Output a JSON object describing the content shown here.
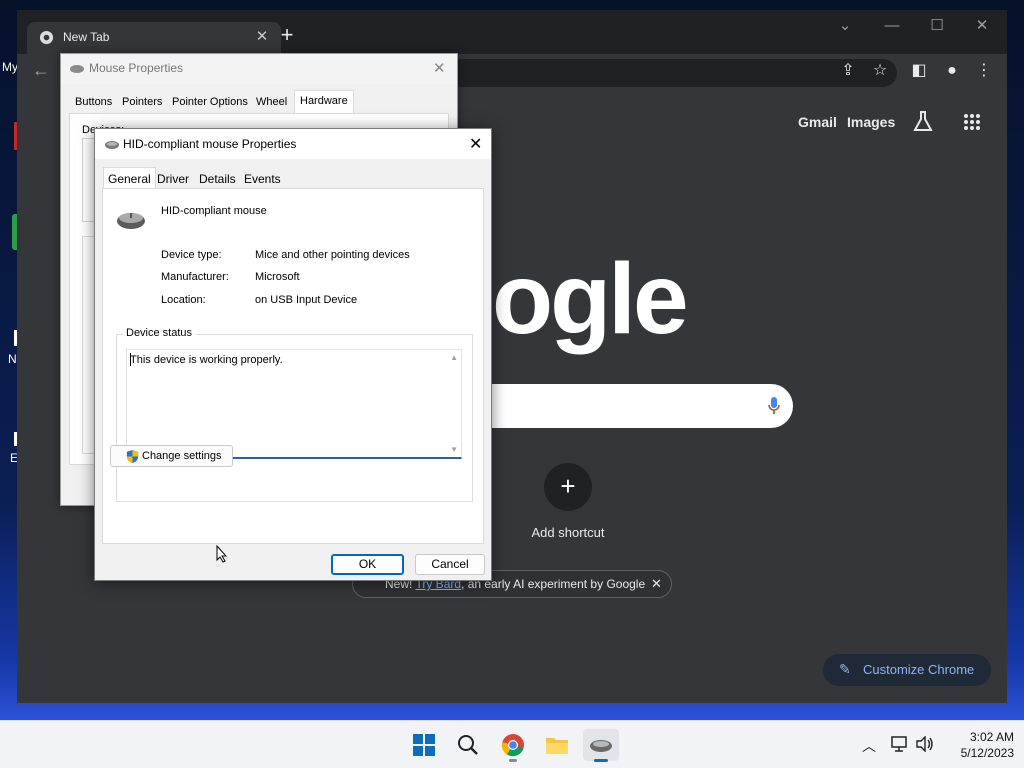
{
  "desktop": {
    "icon_labels": [
      "My",
      "N",
      "E"
    ]
  },
  "chrome": {
    "tab_title": "New Tab",
    "links": {
      "gmail": "Gmail",
      "images": "Images"
    },
    "logo_fragment": "ogle",
    "add_shortcut": "Add shortcut",
    "bard_banner": {
      "new": "New!",
      "link": "Try Bard",
      "rest": ", an early AI experiment by Google"
    },
    "customize": "Customize Chrome",
    "colors": {
      "background": "#35363a",
      "accent": "#8ab4f8"
    }
  },
  "mouse_properties": {
    "title": "Mouse Properties",
    "tabs": [
      "Buttons",
      "Pointers",
      "Pointer Options",
      "Wheel",
      "Hardware"
    ],
    "active_tab": "Hardware",
    "devices_label": "Devices:"
  },
  "hid_dialog": {
    "title": "HID-compliant mouse Properties",
    "tabs": [
      "General",
      "Driver",
      "Details",
      "Events"
    ],
    "active_tab": "General",
    "device_name": "HID-compliant mouse",
    "properties": [
      {
        "label": "Device type:",
        "value": "Mice and other pointing devices"
      },
      {
        "label": "Manufacturer:",
        "value": "Microsoft"
      },
      {
        "label": "Location:",
        "value": "on USB Input Device"
      }
    ],
    "status_group_label": "Device status",
    "status_text": "This device is working properly.",
    "change_settings": "Change settings",
    "ok": "OK",
    "cancel": "Cancel"
  },
  "taskbar": {
    "time": "3:02 AM",
    "date": "5/12/2023",
    "apps": [
      "start-icon",
      "search-icon",
      "chrome-icon",
      "file-explorer-icon",
      "mouse-properties-icon"
    ]
  }
}
